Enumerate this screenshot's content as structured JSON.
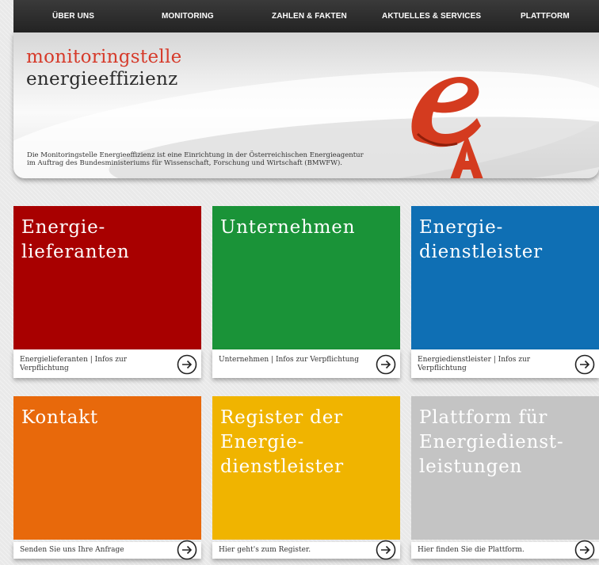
{
  "nav": {
    "items": [
      "ÜBER UNS",
      "MONITORING",
      "ZAHLEN & FAKTEN",
      "AKTUELLES & SERVICES",
      "PLATTFORM"
    ]
  },
  "banner": {
    "brand_line1": "monitoringstelle",
    "brand_line2": "energieeffizienz",
    "desc_line1": "Die Monitoringstelle Energieeffizienz ist eine Einrichtung in der Österreichischen Energieagentur",
    "desc_line2": "im Auftrag des Bundesministeriums für Wissenschaft, Forschung und Wirtschaft (BMWFW).",
    "logo_icon": "ea-logo-icon"
  },
  "tiles": [
    {
      "title": "Energie-\nlieferanten",
      "caption": "Energielieferanten | Infos zur Verpflichtung",
      "color": "#a80000"
    },
    {
      "title": "Unternehmen",
      "caption": "Unternehmen | Infos zur Verpflichtung",
      "color": "#1a9338"
    },
    {
      "title": "Energie-\ndienstleister",
      "caption": "Energiedienstleister | Infos zur Verpflichtung",
      "color": "#0f6fb4"
    },
    {
      "title": "Kontakt",
      "caption": "Senden Sie uns Ihre Anfrage",
      "color": "#e8690b"
    },
    {
      "title": "Register der\nEnergie-\ndienstleister",
      "caption": "Hier geht's zum Register.",
      "color": "#f0b400"
    },
    {
      "title": "Plattform für\nEnergiedienst-\nleistungen",
      "caption": "Hier finden Sie die Plattform.",
      "color": "#c4c4c4"
    }
  ],
  "icons": {
    "arrow": "circle-arrow-right-icon"
  }
}
